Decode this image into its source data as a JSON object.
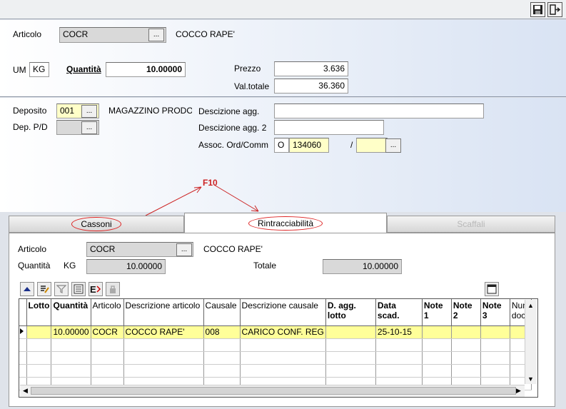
{
  "toolbar": {
    "save_icon": "floppy-disk-icon",
    "exit_icon": "exit-door-icon"
  },
  "header": {
    "articolo_label": "Articolo",
    "articolo_code": "COCR",
    "articolo_desc": "COCCO RAPE'",
    "um_label": "UM",
    "um_value": "KG",
    "quantita_label": "Quantità",
    "quantita_value": "10.00000",
    "prezzo_label": "Prezzo",
    "prezzo_value": "3.636",
    "valtotale_label": "Val.totale",
    "valtotale_value": "36.360"
  },
  "deposito": {
    "deposito_label": "Deposito",
    "deposito_code": "001",
    "deposito_desc": "MAGAZZINO PRODOT",
    "deppd_label": "Dep. P/D",
    "deppd_value": "",
    "descagg_label": "Descizione agg.",
    "descagg_value": "",
    "descagg2_label": "Descizione agg. 2",
    "descagg2_value": "",
    "assoc_label": "Assoc. Ord/Comm",
    "assoc_type": "O",
    "assoc_number": "134060",
    "assoc_sep": "/",
    "assoc_suffix": ""
  },
  "annotation": {
    "label": "F10",
    "color": "#cc2222"
  },
  "tabs": [
    {
      "label": "Cassoni",
      "state": "normal"
    },
    {
      "label": "Rintracciabilità",
      "state": "active"
    },
    {
      "label": "Scaffali",
      "state": "disabled"
    }
  ],
  "panel": {
    "articolo_label": "Articolo",
    "articolo_code": "COCR",
    "articolo_desc": "COCCO RAPE'",
    "quantita_label": "Quantità",
    "quantita_um": "KG",
    "quantita_value": "10.00000",
    "totale_label": "Totale",
    "totale_value": "10.00000"
  },
  "grid": {
    "columns": [
      "Lotto",
      "Quantità",
      "Articolo",
      "Descrizione articolo",
      "Causale",
      "Descrizione causale",
      "D. agg. lotto",
      "Data scad.",
      "Note 1",
      "Note 2",
      "Note 3",
      "Num doc."
    ],
    "rows": [
      [
        "",
        "10.00000",
        "COCR",
        "COCCO RAPE'",
        "008",
        "CARICO CONF. REG",
        "",
        "25-10-15",
        "",
        "",
        "",
        ""
      ]
    ],
    "selected_color": "#ffff99"
  },
  "dots_label": "..."
}
